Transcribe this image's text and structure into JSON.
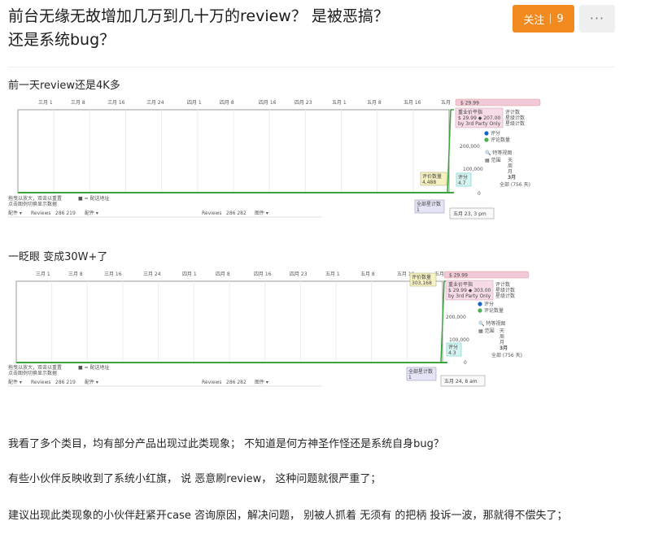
{
  "post": {
    "title_line1": "前台无缘无故增加几万到几十万的review？ 是被恶搞？",
    "title_line2": "还是系统bug？",
    "follow_label": "关注",
    "follow_count": "9",
    "more_label": "···"
  },
  "content": {
    "caption1": "前一天review还是4K多",
    "caption2": "一眨眼 变成30W+了",
    "para1": "我看了多个类目，均有部分产品出现过此类现象； 不知道是何方神圣作怪还是系统自身bug？",
    "para2": "有些小伙伴反映收到了系统小红旗， 说 恶意刷review， 这种问题就很严重了；",
    "para3": "建议出现此类现象的小伙伴赶紧开case 咨询原因，解决问题， 别被人抓着 无须有 的把柄 投诉一波，那就得不偿失了；"
  },
  "charts": [
    {
      "months": [
        "三月 1",
        "三月 8",
        "三月 16",
        "三月 24",
        "四月 1",
        "四月 8",
        "四月 16",
        "四月 23",
        "五月 1",
        "五月 8",
        "五月 16",
        "五月"
      ],
      "price_tag": "$ 29.99",
      "pill1": "重业价平指",
      "pill2": "$ 29.99 ◆ 207.00",
      "pill3": "by 3rd Party Only",
      "legend_review": "评分",
      "legend_count": "评论数量",
      "right1": "评计数",
      "right2": "星级计数",
      "right3": "星级计数",
      "axis_top": "200,000",
      "axis_mid": "100,000",
      "axis_zero": "0",
      "zoom_label": "特等视图",
      "range_label": "范围",
      "day_label": "天",
      "week_label": "周",
      "month_label": "月",
      "three_label": "3月",
      "all_label": "全部 (756 天)",
      "review_tag_label": "评价数量",
      "review_tag_value": "4,488",
      "rating_label": "评分",
      "rating_value": "4.7",
      "star_label": "全部星计数",
      "star_value": "1",
      "date_tip": "五月 23, 3 pm",
      "foot1": "拖曳以放大，双击以重置",
      "foot2": "点击图例切换显示数据",
      "foot3": "■ = 配送地址",
      "foot_a": "配件 ▾",
      "foot_b": "Reviews",
      "foot_c": "286 219",
      "foot_d": "配件 ▾",
      "foot_e": "Reviews",
      "foot_f": "286 282",
      "foot_g": "图件 ▾"
    },
    {
      "months": [
        "三月 1",
        "三月 8",
        "三月 16",
        "三月 24",
        "四月 1",
        "四月 8",
        "四月 16",
        "四月 23",
        "五月 1",
        "五月 8",
        "五月 16",
        "五月"
      ],
      "price_tag": "$ 29.99",
      "pill1": "重业价平指",
      "pill2": "$ 29.99 ◆ 303.00",
      "pill3": "by 3rd Party Only",
      "legend_review": "评分",
      "legend_count": "评论数量",
      "right1": "评计数",
      "right2": "星级计数",
      "right3": "星级计数",
      "axis_top": "200,000",
      "axis_mid": "100,000",
      "axis_zero": "0",
      "zoom_label": "特等视图",
      "range_label": "范围",
      "day_label": "天",
      "week_label": "周",
      "month_label": "月",
      "three_label": "3月",
      "all_label": "全部 (756 天)",
      "review_tag_label": "评价数量",
      "review_tag_value": "303,168",
      "rating_label": "评分",
      "rating_value": "4.3",
      "star_label": "全部星计数",
      "star_value": "1",
      "date_tip": "五月 24, 8 am",
      "foot1": "拖曳以放大，双击以重置",
      "foot2": "点击图例切换显示数据",
      "foot3": "■ = 配送地址",
      "foot_a": "配件 ▾",
      "foot_b": "Reviews",
      "foot_c": "286 219",
      "foot_d": "配件 ▾",
      "foot_e": "Reviews",
      "foot_f": "286 282",
      "foot_g": "图件 ▾"
    }
  ],
  "colors": {
    "accent": "#f28b1f",
    "green_line": "#3aa53a",
    "pill_bg": "#f2c9d9",
    "tag_yellow": "#f6f2c4",
    "tag_teal": "#d6f3f0",
    "tag_blue": "#e4e4f6"
  }
}
